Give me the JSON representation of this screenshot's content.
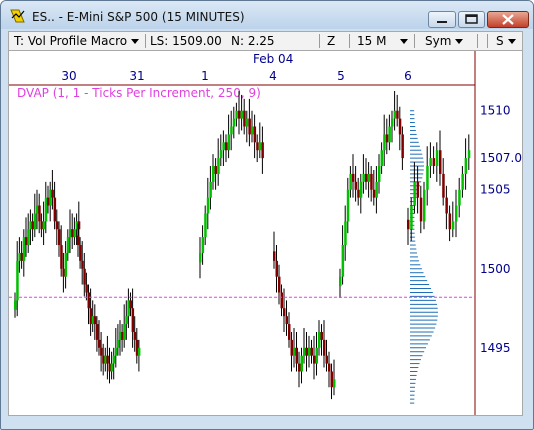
{
  "window": {
    "title": "ES.. - E-Mini S&P 500 (15 MINUTES)",
    "controls": [
      "minimize",
      "maximize",
      "close"
    ]
  },
  "toolbar": {
    "macro_label": "T: Vol Profile Macro",
    "last_sale": "LS: 1509.00",
    "net_change": "N: 2.25",
    "zoom_label": "Z",
    "interval_label": "15 M",
    "symbol_label": "Sym",
    "scale_label": "S"
  },
  "colors": {
    "up_bar": "#00c000",
    "down_bar": "#800000",
    "wick": "#000000",
    "profile": "#1e6fb8",
    "dvap_line": "#e040e0",
    "axis_line": "#800000",
    "axis_text": "#00008b",
    "window_frame": "#cfe0f1"
  },
  "chart": {
    "month_label": "Feb 04",
    "date_labels": [
      "30",
      "31",
      "1",
      "4",
      "5",
      "6"
    ],
    "study_label": "DVAP (1, 1 - Ticks Per Increment, 250, 9)",
    "price_labels": [
      "1510",
      "1507.0",
      "1505",
      "1500",
      "1495"
    ],
    "price_label_values": [
      1510,
      1507,
      1505,
      1500,
      1495
    ],
    "dvap_level": 1498.2,
    "last_price": 1507.0
  },
  "chart_data": {
    "type": "candlestick",
    "y_range": [
      1491,
      1511.5
    ],
    "segments": [
      {
        "label": "30",
        "closes": [
          1498,
          1500.5,
          1501,
          1500.5,
          1502,
          1501.5,
          1502.5,
          1503,
          1502.5,
          1503.5,
          1504,
          1503,
          1502.5,
          1503,
          1504.5,
          1504,
          1505,
          1504.5,
          1503,
          1502.5,
          1501.5,
          1500,
          1499.5,
          1501,
          1502,
          1502.5,
          1502,
          1502.5,
          1503,
          1502.5
        ]
      },
      {
        "label": "31",
        "closes": [
          1501.5,
          1500.5,
          1500,
          1499,
          1498.5,
          1497.5,
          1496.5,
          1497,
          1496.5,
          1495.5,
          1495,
          1494.5,
          1494,
          1494.5,
          1494,
          1493.5,
          1494,
          1494.5,
          1495,
          1495.5,
          1496,
          1495.5,
          1496.5,
          1497,
          1498,
          1497.5,
          1496,
          1495.5,
          1494.5,
          1495
        ]
      },
      {
        "label": "1",
        "closes": [
          1501,
          1502,
          1503.5,
          1504.5,
          1505.5,
          1506.5,
          1506,
          1507,
          1507.5,
          1508,
          1507.5,
          1508.5,
          1509,
          1509.5,
          1510,
          1509.5,
          1510,
          1509,
          1509.5,
          1508.5,
          1509,
          1508,
          1507.5,
          1508,
          1507
        ]
      },
      {
        "label": "4",
        "closes": [
          1500.5,
          1499.5,
          1498.5,
          1497.5,
          1497,
          1496.5,
          1495.5,
          1494.5,
          1495,
          1494,
          1493.5,
          1494.5,
          1495,
          1494.5,
          1495,
          1494.5,
          1494,
          1495,
          1496,
          1495.5,
          1494.5,
          1494,
          1493.5,
          1492.5,
          1493
        ]
      },
      {
        "label": "5",
        "closes": [
          1499.5,
          1501.5,
          1503,
          1505,
          1506,
          1505.5,
          1505,
          1504.5,
          1505.5,
          1506,
          1505.5,
          1506,
          1505,
          1504.5,
          1505.5,
          1506.5,
          1507.5,
          1508.5,
          1508,
          1509,
          1509.5,
          1510,
          1509.5,
          1508.5,
          1507
        ]
      },
      {
        "label": "6",
        "closes": [
          1502.5,
          1504,
          1505.5,
          1504.5,
          1503,
          1505,
          1506.5,
          1507,
          1506.5,
          1507.5,
          1506,
          1504.5,
          1503.5,
          1502.5,
          1503,
          1504,
          1505,
          1506,
          1507,
          1507.5
        ]
      }
    ],
    "profile_y_range": [
      1491.5,
      1510
    ],
    "profile_step": 0.25
  }
}
